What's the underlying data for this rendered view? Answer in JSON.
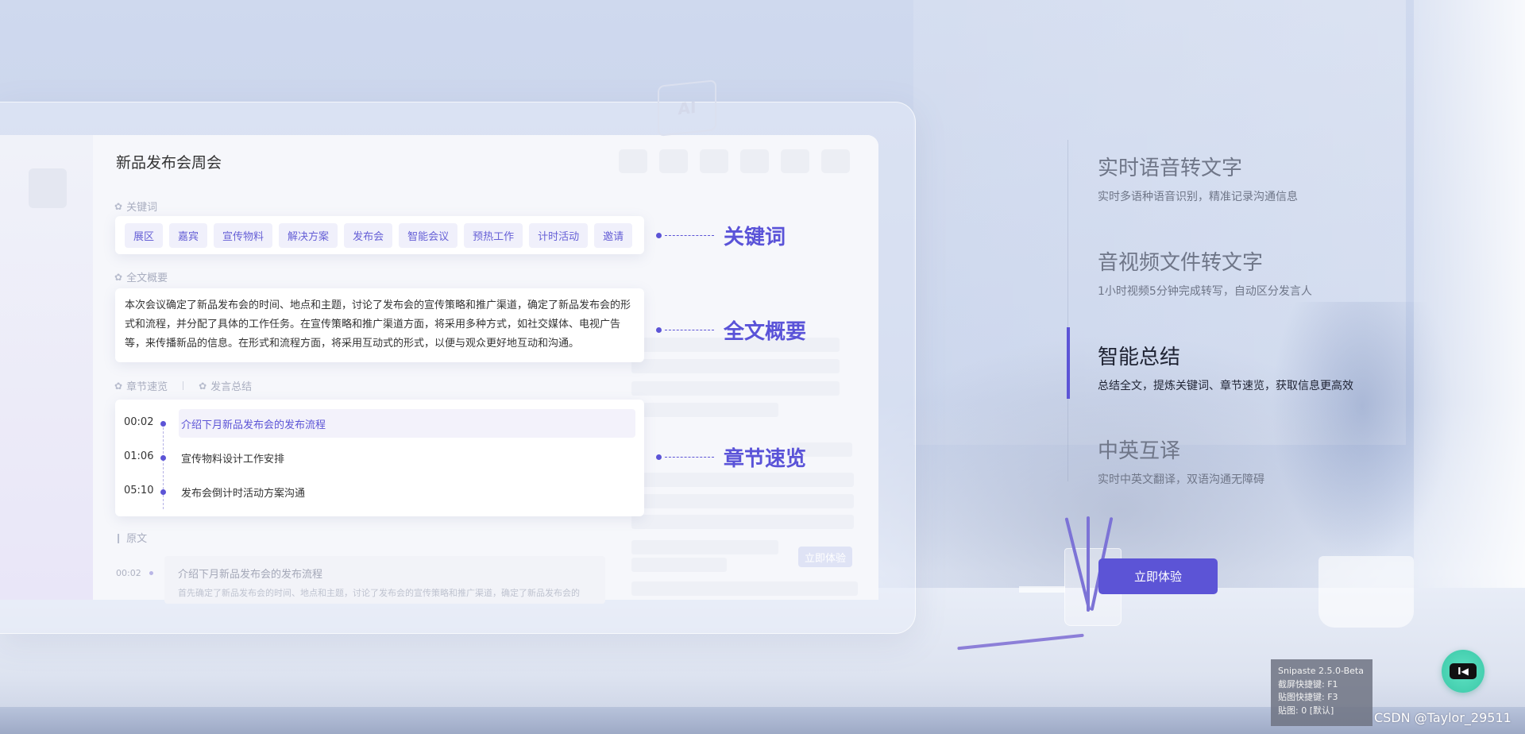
{
  "app": {
    "title": "新品发布会周会",
    "sections": {
      "keywords": "关键词",
      "summary": "全文概要",
      "chapters": "章节速览",
      "speaker_summary": "发言总结",
      "raw": "原文"
    },
    "keywords": [
      "展区",
      "嘉宾",
      "宣传物料",
      "解决方案",
      "发布会",
      "智能会议",
      "预热工作",
      "计时活动",
      "邀请"
    ],
    "summary_text": "本次会议确定了新品发布会的时间、地点和主题，讨论了发布会的宣传策略和推广渠道，确定了新品发布会的形式和流程，并分配了具体的工作任务。在宣传策略和推广渠道方面，将采用多种方式，如社交媒体、电视广告等，来传播新品的信息。在形式和流程方面，将采用互动式的形式，以便与观众更好地互动和沟通。",
    "chapters": [
      {
        "time": "00:02",
        "title": "介绍下月新品发布会的发布流程"
      },
      {
        "time": "01:06",
        "title": "宣传物料设计工作安排"
      },
      {
        "time": "05:10",
        "title": "发布会倒计时活动方案沟通"
      }
    ],
    "raw": {
      "time": "00:02",
      "title": "介绍下月新品发布会的发布流程",
      "desc": "首先确定了新品发布会的时间、地点和主题，讨论了发布会的宣传策略和推广渠道，确定了新品发布会的"
    },
    "ghost_ai": "AI",
    "ghost_button": "立即体验"
  },
  "callouts": [
    "关键词",
    "全文概要",
    "章节速览"
  ],
  "features": [
    {
      "title": "实时语音转文字",
      "desc": "实时多语种语音识别，精准记录沟通信息"
    },
    {
      "title": "音视频文件转文字",
      "desc": "1小时视频5分钟完成转写，自动区分发言人"
    },
    {
      "title": "智能总结",
      "desc": "总结全文，提炼关键词、章节速览，获取信息更高效"
    },
    {
      "title": "中英互译",
      "desc": "实时中英文翻译，双语沟通无障碍"
    }
  ],
  "cta": "立即体验",
  "snipaste": [
    "Snipaste 2.5.0-Beta",
    "截屏快捷键: F1",
    "贴图快捷键: F3",
    "贴图: 0 [默认]"
  ],
  "watermark": "CSDN @Taylor_29511",
  "float_button_label": "I◀",
  "colors": {
    "accent": "#5c54d6",
    "float": "#3ac8a7"
  }
}
